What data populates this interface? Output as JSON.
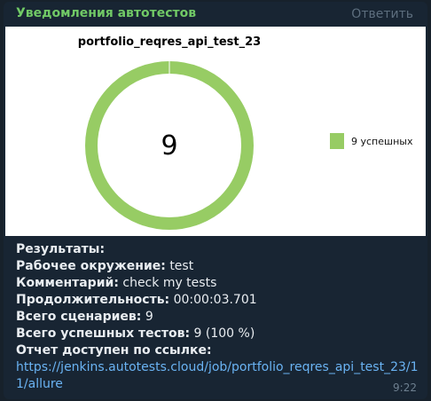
{
  "message": {
    "sender": "Уведомления автотестов",
    "reply_label": "Ответить",
    "time": "9:22",
    "results_heading": "Результаты:",
    "fields": [
      {
        "label": "Рабочее окружение:",
        "value": "test"
      },
      {
        "label": "Комментарий:",
        "value": "check my tests"
      },
      {
        "label": "Продолжительность:",
        "value": "00:00:03.701"
      },
      {
        "label": "Всего сценариев:",
        "value": "9"
      },
      {
        "label": "Всего успешных тестов:",
        "value": "9 (100 %)"
      }
    ],
    "report_label": "Отчет доступен по ссылке:",
    "report_link": "https://jenkins.autotests.cloud/job/portfolio_reqres_api_test_23/11/allure"
  },
  "chart_data": {
    "type": "pie",
    "title": "portfolio_reqres_api_test_23",
    "center_label": "9",
    "slices": [
      {
        "label": "9 успешных",
        "value": 9,
        "color": "#97cc64"
      }
    ],
    "legend_position": "right"
  }
}
